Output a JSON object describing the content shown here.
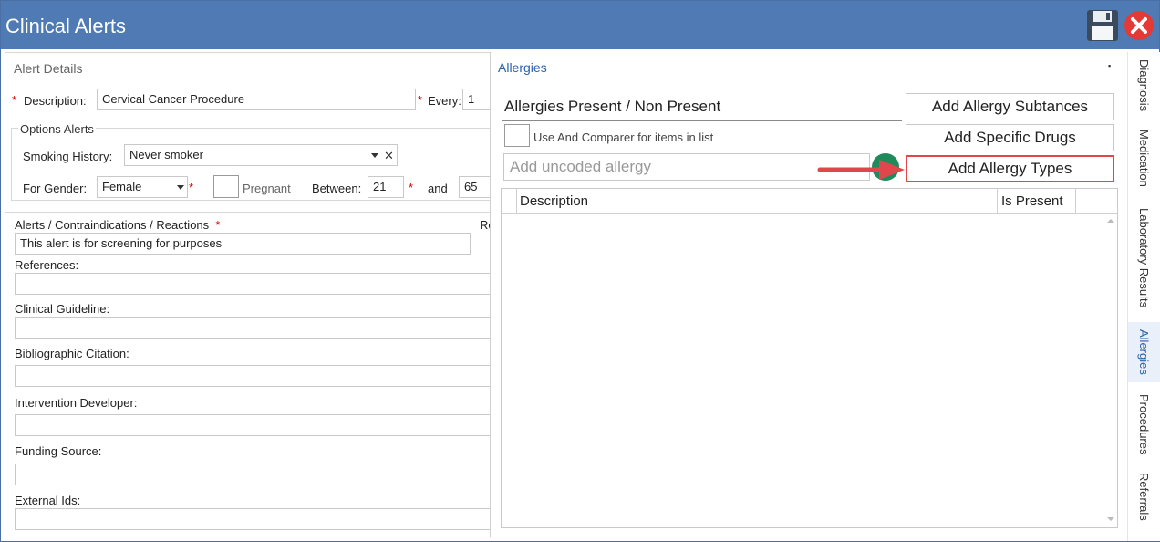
{
  "window": {
    "title": "Clinical Alerts",
    "title_bar_color": "#4f7ab3",
    "save_icon": "floppy-disk-icon",
    "close_icon": "red-x-circle-icon"
  },
  "alert_details": {
    "section_title": "Alert Details",
    "required_marker": "*",
    "description_label": "Description:",
    "description_value": "Cervical Cancer Procedure",
    "every_label": "Every:",
    "every_value": "1",
    "options_title": "Options Alerts",
    "smoking_label": "Smoking History:",
    "smoking_value": "Never smoker",
    "clear_glyph": "✕",
    "gender_label": "For Gender:",
    "gender_value": "Female",
    "pregnant_label": "Pregnant",
    "between_label": "Between:",
    "between_from": "21",
    "and_label": "and",
    "between_to": "65"
  },
  "fields": {
    "alerts_label": "Alerts / Contraindications / Reactions",
    "alerts_value": "This alert is for screening for purposes",
    "cut_label": "Re",
    "references_label": "References:",
    "guideline_label": "Clinical Guideline:",
    "citation_label": "Bibliographic Citation:",
    "developer_label": "Intervention Developer:",
    "funding_label": "Funding Source:",
    "external_label": "External Ids:"
  },
  "allergies": {
    "title": "Allergies",
    "pin_glyph": "▪",
    "present_label": "Allergies Present / Non Present",
    "use_and_label": "Use And Comparer for items in list",
    "uncoded_placeholder": "Add uncoded allergy",
    "buttons": {
      "subtances": "Add Allergy Subtances",
      "drugs": "Add Specific Drugs",
      "types": "Add Allergy Types"
    },
    "highlight_color": "#e0474c",
    "grid_columns": [
      "Description",
      "Is Present"
    ]
  },
  "side_tabs": [
    {
      "label": "Diagnosis",
      "active": false
    },
    {
      "label": "Medication",
      "active": false
    },
    {
      "label": "Laboratory Results",
      "active": false
    },
    {
      "label": "Allergies",
      "active": true
    },
    {
      "label": "Procedures",
      "active": false
    },
    {
      "label": "Referrals",
      "active": false
    }
  ]
}
